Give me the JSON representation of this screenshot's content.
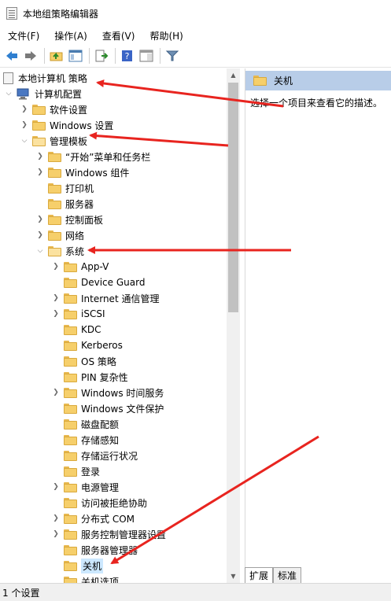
{
  "window": {
    "title": "本地组策略编辑器"
  },
  "menu": [
    {
      "label": "文件(F)"
    },
    {
      "label": "操作(A)"
    },
    {
      "label": "查看(V)"
    },
    {
      "label": "帮助(H)"
    }
  ],
  "toolbar": {
    "icons": [
      "back-arrow-icon",
      "forward-arrow-icon",
      "up-folder-icon",
      "show-hide-tree-icon",
      "export-list-icon",
      "help-icon",
      "properties-pane-icon",
      "filter-icon"
    ]
  },
  "tree": {
    "root": "本地计算机 策略",
    "computer_config": "计算机配置",
    "software_settings": "软件设置",
    "windows_settings": "Windows 设置",
    "admin_templates": "管理模板",
    "start_menu": "“开始”菜单和任务栏",
    "windows_components": "Windows 组件",
    "printers": "打印机",
    "servers": "服务器",
    "control_panel": "控制面板",
    "network": "网络",
    "system": "系统",
    "system_children": [
      {
        "label": "App-V",
        "expandable": true
      },
      {
        "label": "Device Guard",
        "expandable": false
      },
      {
        "label": "Internet 通信管理",
        "expandable": true
      },
      {
        "label": "iSCSI",
        "expandable": true
      },
      {
        "label": "KDC",
        "expandable": false
      },
      {
        "label": "Kerberos",
        "expandable": false
      },
      {
        "label": "OS 策略",
        "expandable": false
      },
      {
        "label": "PIN 复杂性",
        "expandable": false
      },
      {
        "label": "Windows 时间服务",
        "expandable": true
      },
      {
        "label": "Windows 文件保护",
        "expandable": false
      },
      {
        "label": "磁盘配额",
        "expandable": false
      },
      {
        "label": "存储感知",
        "expandable": false
      },
      {
        "label": "存储运行状况",
        "expandable": false
      },
      {
        "label": "登录",
        "expandable": false
      },
      {
        "label": "电源管理",
        "expandable": true
      },
      {
        "label": "访问被拒绝协助",
        "expandable": false
      },
      {
        "label": "分布式 COM",
        "expandable": true
      },
      {
        "label": "服务控制管理器设置",
        "expandable": true
      },
      {
        "label": "服务器管理器",
        "expandable": false
      },
      {
        "label": "关机",
        "expandable": false,
        "selected": true
      },
      {
        "label": "关机选项",
        "expandable": false
      }
    ]
  },
  "right_pane": {
    "header": "关机",
    "description": "选择一个项目来查看它的描述。"
  },
  "tabs": [
    {
      "label": "扩展",
      "active": true
    },
    {
      "label": "标准",
      "active": false
    }
  ],
  "status": {
    "text": "1 个设置"
  },
  "colors": {
    "selection": "#cce8ff",
    "header_bg": "#b8cde8",
    "folder": "#f6cf6b",
    "annotation_arrow": "#e8241f"
  }
}
